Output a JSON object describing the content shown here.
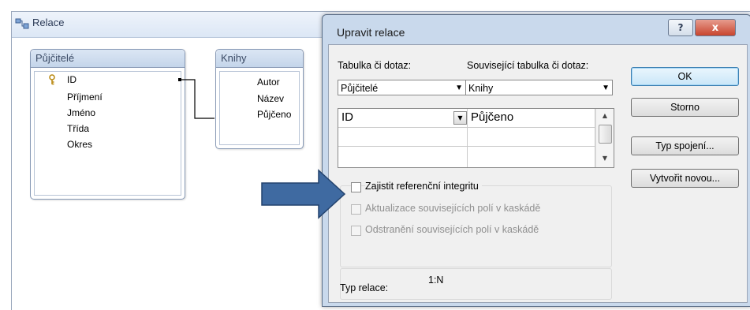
{
  "relationship_window": {
    "title": "Relace",
    "tables": [
      {
        "name": "Půjčitelé",
        "key_field": "ID",
        "fields": [
          "ID",
          "Příjmení",
          "Jméno",
          "Třída",
          "Okres"
        ]
      },
      {
        "name": "Knihy",
        "fields": [
          "Autor",
          "Název",
          "Půjčeno"
        ]
      }
    ]
  },
  "dialog": {
    "title": "Upravit relace",
    "help_label": "?",
    "close_label": "x",
    "table_label": "Tabulka či dotaz:",
    "related_label": "Související tabulka či dotaz:",
    "table_value": "Půjčitelé",
    "related_value": "Knihy",
    "grid": {
      "left_field": "ID",
      "right_field": "Půjčeno"
    },
    "checkboxes": {
      "referential": "Zajistit referenční integritu",
      "cascade_update": "Aktualizace souvisejících polí v kaskádě",
      "cascade_delete": "Odstranění souvisejících polí v kaskádě"
    },
    "relation_type_label": "Typ relace:",
    "relation_type_value": "1:N",
    "buttons": {
      "ok": "OK",
      "cancel": "Storno",
      "join_type": "Typ spojení...",
      "create_new": "Vytvořit novou..."
    }
  },
  "colors": {
    "arrow": "#3f6aa1",
    "dialog_frame": "#c9d9ec",
    "close_button": "#c8452e"
  }
}
